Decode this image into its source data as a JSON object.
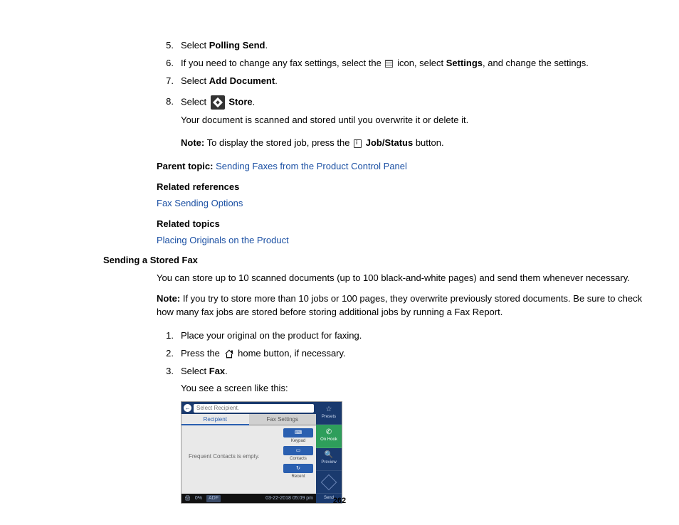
{
  "steps_a": [
    {
      "n": "5.",
      "pre": "Select ",
      "bold": "Polling Send",
      "post": "."
    },
    {
      "n": "6.",
      "pre": "If you need to change any fax settings, select the ",
      "icon": "menu",
      "mid": " icon, select ",
      "bold": "Settings",
      "post": ", and change the settings."
    },
    {
      "n": "7.",
      "pre": "Select ",
      "bold": "Add Document",
      "post": "."
    },
    {
      "n": "8.",
      "pre": "Select ",
      "icon": "store",
      "mid": " ",
      "bold": "Store",
      "post": "."
    }
  ],
  "sub_scanned": "Your document is scanned and stored until you overwrite it or delete it.",
  "note1_label": "Note:",
  "note1_pre": " To display the stored job, press the ",
  "note1_bold": "Job/Status",
  "note1_post": " button.",
  "parent_label": "Parent topic:",
  "parent_link": "Sending Faxes from the Product Control Panel",
  "related_refs_label": "Related references",
  "related_refs_link": "Fax Sending Options",
  "related_topics_label": "Related topics",
  "related_topics_link": "Placing Originals on the Product",
  "h2": "Sending a Stored Fax",
  "intro": "You can store up to 10 scanned documents (up to 100 black-and-white pages) and send them whenever necessary.",
  "note2_label": "Note:",
  "note2_body": " If you try to store more than 10 jobs or 100 pages, they overwrite previously stored documents. Be sure to check how many fax jobs are stored before storing additional jobs by running a Fax Report.",
  "steps_b": [
    {
      "n": "1.",
      "text": "Place your original on the product for faxing."
    },
    {
      "n": "2.",
      "pre": "Press the ",
      "icon": "home",
      "post": " home button, if necessary."
    },
    {
      "n": "3.",
      "pre": "Select ",
      "bold": "Fax",
      "post": "."
    }
  ],
  "sub_seescreen": "You see a screen like this:",
  "fax": {
    "select_recipient": "Select Recipient.",
    "tab_recipient": "Recipient",
    "tab_settings": "Fax Settings",
    "empty": "Frequent Contacts is empty.",
    "btn_keypad": "Keypad",
    "btn_contacts": "Contacts",
    "btn_recent": "Recent",
    "right_presets": "Presets",
    "right_onhook": "On Hook",
    "right_preview": "Preview",
    "right_send": "Send",
    "status_pct": "0%",
    "status_adf": "ADF",
    "status_dt": "03-22-2018 05:09 pm"
  },
  "page_num": "262"
}
